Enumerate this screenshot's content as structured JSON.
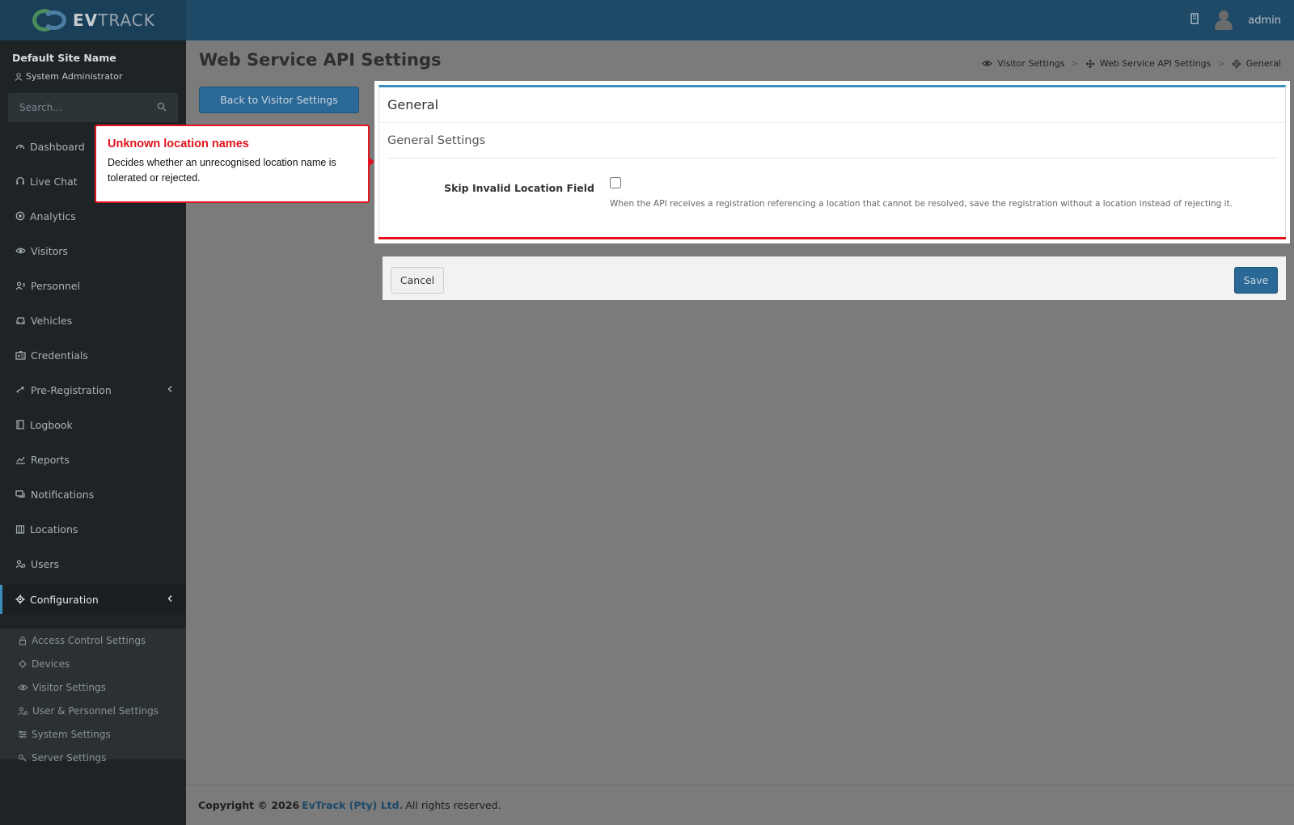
{
  "header": {
    "brand_ev": "EV",
    "brand_track": "TRACK",
    "user_name": "admin"
  },
  "sidebar": {
    "site_name": "Default Site Name",
    "role": "System Administrator",
    "search_placeholder": "Search...",
    "items": [
      {
        "label": "Dashboard",
        "icon": "dashboard-icon"
      },
      {
        "label": "Live Chat",
        "icon": "headset-icon"
      },
      {
        "label": "Analytics",
        "icon": "target-icon"
      },
      {
        "label": "Visitors",
        "icon": "eye-icon"
      },
      {
        "label": "Personnel",
        "icon": "user-group-icon"
      },
      {
        "label": "Vehicles",
        "icon": "car-icon"
      },
      {
        "label": "Credentials",
        "icon": "id-card-icon"
      },
      {
        "label": "Pre-Registration",
        "icon": "exchange-icon"
      },
      {
        "label": "Logbook",
        "icon": "book-icon"
      },
      {
        "label": "Reports",
        "icon": "chart-icon"
      },
      {
        "label": "Notifications",
        "icon": "chat-icon"
      },
      {
        "label": "Locations",
        "icon": "building-icon"
      },
      {
        "label": "Users",
        "icon": "users-icon"
      },
      {
        "label": "Configuration",
        "icon": "gear-icon"
      }
    ],
    "sub_items": [
      {
        "label": "Access Control Settings",
        "icon": "lock-icon"
      },
      {
        "label": "Devices",
        "icon": "device-icon"
      },
      {
        "label": "Visitor Settings",
        "icon": "eye-icon"
      },
      {
        "label": "User & Personnel Settings",
        "icon": "users-icon"
      },
      {
        "label": "System Settings",
        "icon": "sliders-icon"
      },
      {
        "label": "Server Settings",
        "icon": "key-icon"
      }
    ]
  },
  "main": {
    "page_title": "Web Service API Settings",
    "breadcrumb": [
      "Visitor Settings",
      "Web Service API Settings",
      "General"
    ],
    "back_button": "Back to Visitor Settings",
    "card_title": "General",
    "section_title": "General Settings",
    "field_label": "Skip Invalid Location Field",
    "field_checked": false,
    "field_help": "When the API receives a registration referencing a location that cannot be resolved, save the registration without a location instead of rejecting it.",
    "cancel_button": "Cancel",
    "save_button": "Save"
  },
  "footer": {
    "copyright": "Copyright © 2026",
    "company": "EvTrack (Pty) Ltd.",
    "rights": "All rights reserved."
  },
  "callout": {
    "title": "Unknown location names",
    "text": "Decides whether an unrecognised location name is tolerated or rejected."
  },
  "colors": {
    "accent": "#3c8dbc",
    "primary_button": "#2a6896",
    "highlight": "#e0141f"
  }
}
